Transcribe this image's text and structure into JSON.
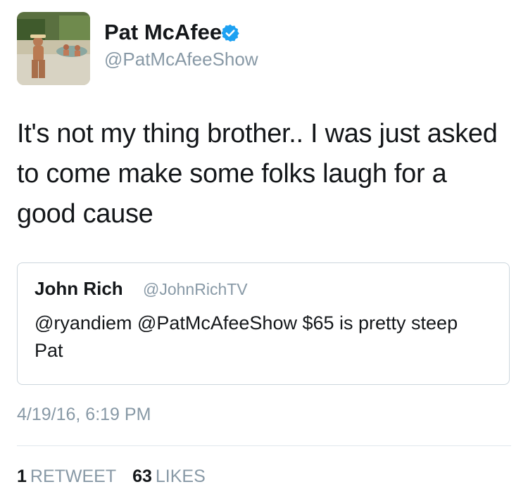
{
  "author": {
    "name": "Pat McAfee",
    "handle": "@PatMcAfeeShow",
    "verified": true
  },
  "tweet": {
    "text": "It's not my thing brother.. I was just asked to come make some folks laugh for a good cause",
    "timestamp": "4/19/16, 6:19 PM"
  },
  "quoted_tweet": {
    "name": "John Rich",
    "handle": "@JohnRichTV",
    "text": "@ryandiem @PatMcAfeeShow $65 is pretty steep Pat"
  },
  "stats": {
    "retweets_count": "1",
    "retweets_label": "RETWEET",
    "likes_count": "63",
    "likes_label": "LIKES"
  },
  "colors": {
    "primary_text": "#14171a",
    "secondary_text": "#8899a6",
    "verified_blue": "#1da1f2",
    "border": "#ccd6dd"
  },
  "icons": {
    "verified": "verified-badge-icon"
  }
}
